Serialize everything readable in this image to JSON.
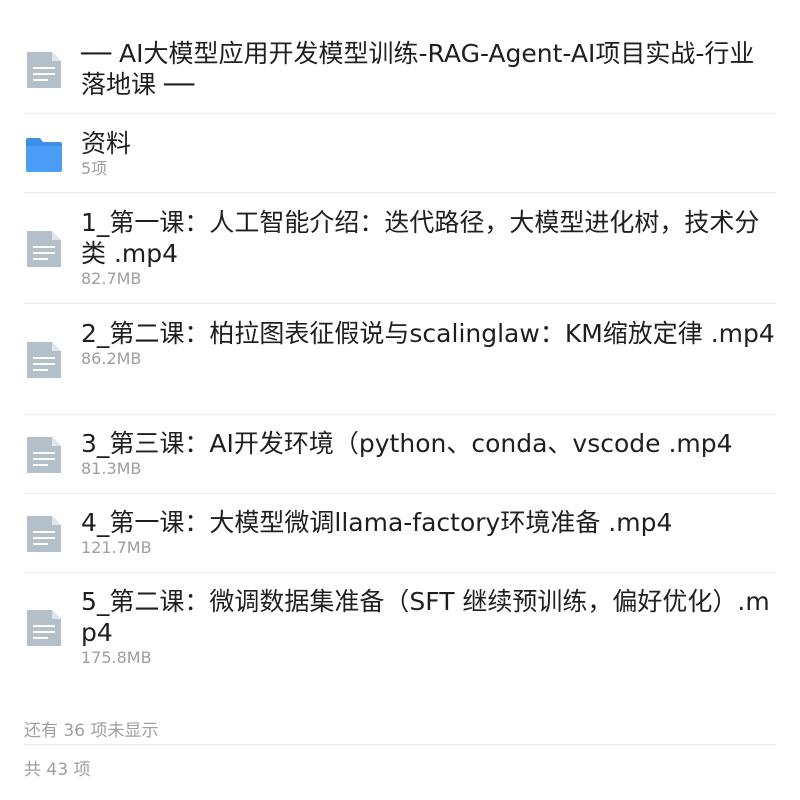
{
  "header_item": {
    "title": "── AI大模型应用开发模型训练-RAG-Agent-AI项目实战-行业落地课 ──",
    "icon": "document-icon"
  },
  "items": [
    {
      "type": "folder",
      "icon": "folder-icon",
      "title": "资料",
      "meta": "5项"
    },
    {
      "type": "file",
      "icon": "document-icon",
      "title": "1_第一课：人工智能介绍：迭代路径，大模型进化树，技术分类 .mp4",
      "meta": "82.7MB"
    },
    {
      "type": "file",
      "icon": "document-icon",
      "title": "2_第二课：柏拉图表征假说与scalinglaw：KM缩放定律 .mp4",
      "meta": "86.2MB"
    },
    {
      "type": "file",
      "icon": "document-icon",
      "title": "3_第三课：AI开发环境（python、conda、vscode .mp4",
      "meta": "81.3MB"
    },
    {
      "type": "file",
      "icon": "document-icon",
      "title": "4_第一课：大模型微调llama-factory环境准备 .mp4",
      "meta": "121.7MB"
    },
    {
      "type": "file",
      "icon": "document-icon",
      "title": "5_第二课：微调数据集准备（SFT 继续预训练，偏好优化）.mp4",
      "meta": "175.8MB"
    }
  ],
  "footer": {
    "hidden_count_text": "还有 36 项未显示",
    "total_text": "共 43 项"
  },
  "colors": {
    "folder": "#4a9ef5",
    "document_icon": "#b3bfc9",
    "meta_text": "#9e9e9e",
    "divider": "#ebebeb"
  }
}
